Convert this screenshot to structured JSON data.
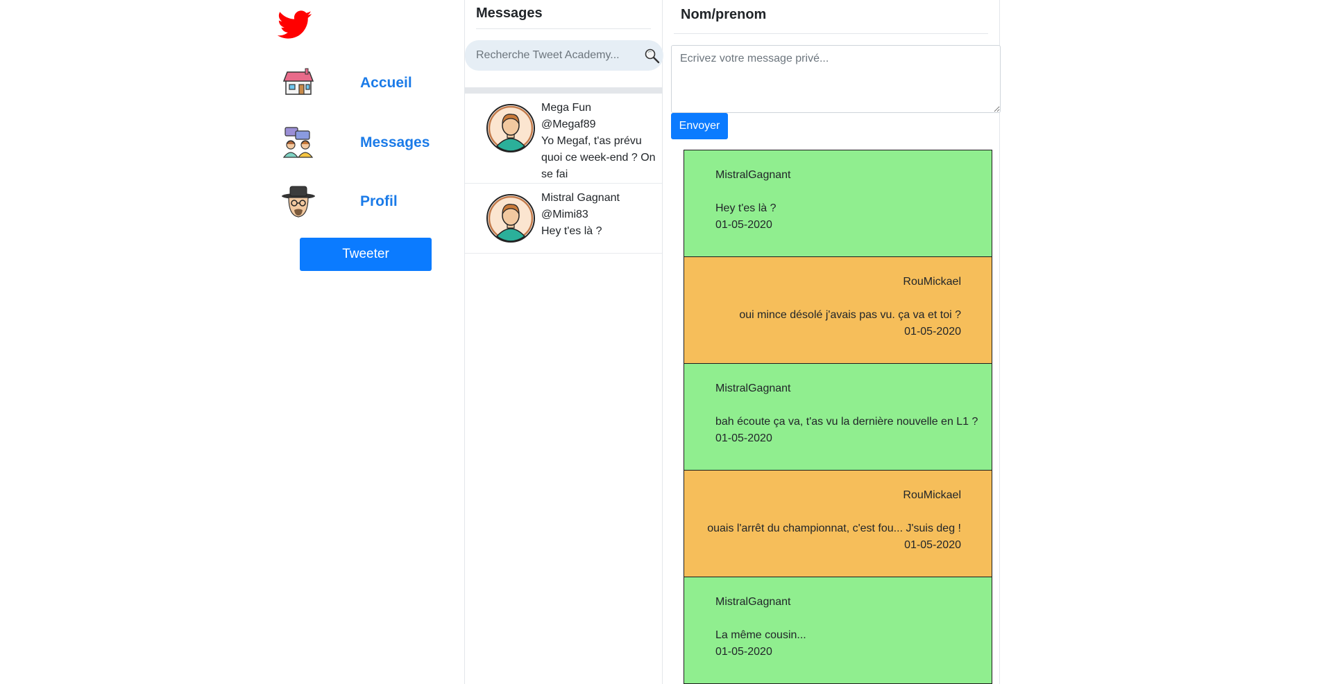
{
  "brand": {
    "logo_icon": "twitter-bird-icon",
    "color": "#ff0000"
  },
  "nav": {
    "items": [
      {
        "label": "Accueil",
        "icon": "house-icon"
      },
      {
        "label": "Messages",
        "icon": "chat-people-icon"
      },
      {
        "label": "Profil",
        "icon": "heisenberg-avatar-icon"
      }
    ],
    "tweet_label": "Tweeter",
    "accent": "#0b7bff"
  },
  "conversations": {
    "title": "Messages",
    "search_placeholder": "Recherche Tweet Academy...",
    "items": [
      {
        "name": "Mega Fun",
        "handle": "@Megaf89",
        "preview": "Yo Megaf, t'as prévu quoi ce week-end ? On se fai"
      },
      {
        "name": "Mistral Gagnant",
        "handle": "@Mimi83",
        "preview": "Hey t'es là ?"
      }
    ]
  },
  "chat": {
    "title": "Nom/prenom",
    "compose_placeholder": "Ecrivez votre message privé...",
    "send_label": "Envoyer",
    "colors": {
      "incoming": "#90ee8f",
      "outgoing": "#f6be5a"
    },
    "messages": [
      {
        "author": "MistralGagnant",
        "text": "Hey t'es là ?",
        "date": "01-05-2020",
        "side": "left"
      },
      {
        "author": "RouMickael",
        "text": "oui mince désolé j'avais pas vu. ça va et toi ?",
        "date": "01-05-2020",
        "side": "right"
      },
      {
        "author": "MistralGagnant",
        "text": "bah écoute ça va, t'as vu la dernière nouvelle en L1 ?",
        "date": "01-05-2020",
        "side": "left"
      },
      {
        "author": "RouMickael",
        "text": "ouais l'arrêt du championnat, c'est fou... J'suis deg !",
        "date": "01-05-2020",
        "side": "right"
      },
      {
        "author": "MistralGagnant",
        "text": "La même cousin...",
        "date": "01-05-2020",
        "side": "left"
      }
    ]
  }
}
